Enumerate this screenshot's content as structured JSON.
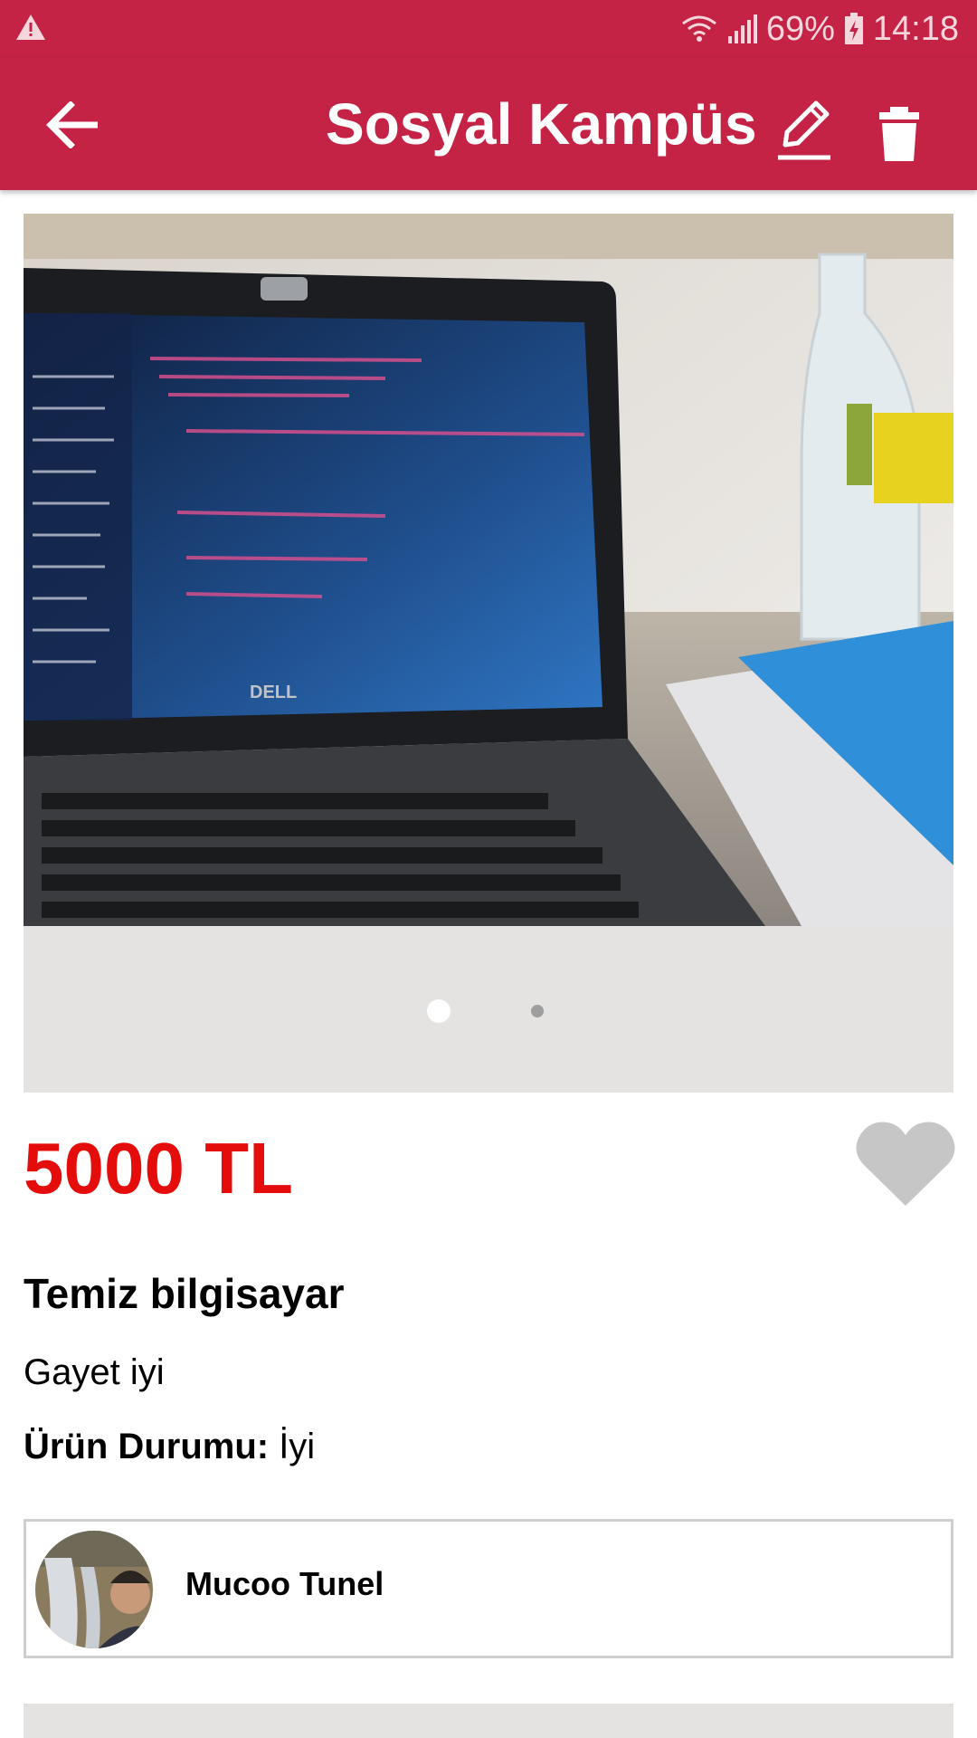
{
  "status_bar": {
    "battery": "69%",
    "time": "14:18",
    "icons": [
      "warning-icon",
      "wifi-icon",
      "signal-icon",
      "battery-charging-icon"
    ]
  },
  "app_bar": {
    "title": "Sosyal Kampüs",
    "icons": [
      "back-arrow-icon",
      "edit-pencil-icon",
      "trash-icon"
    ]
  },
  "gallery": {
    "image_count": 2,
    "active_index": 0
  },
  "listing": {
    "price": "5000 TL",
    "title": "Temiz bilgisayar",
    "description": "Gayet iyi",
    "condition_label": "Ürün Durumu:",
    "condition_value": " İyi",
    "favorite_icon": "heart-icon"
  },
  "seller": {
    "name": "Mucoo Tunel"
  },
  "colors": {
    "brand": "#c42345",
    "price": "#e50c0c",
    "gallery_bg": "#e5e2e2",
    "heart": "#c6c6c6"
  }
}
